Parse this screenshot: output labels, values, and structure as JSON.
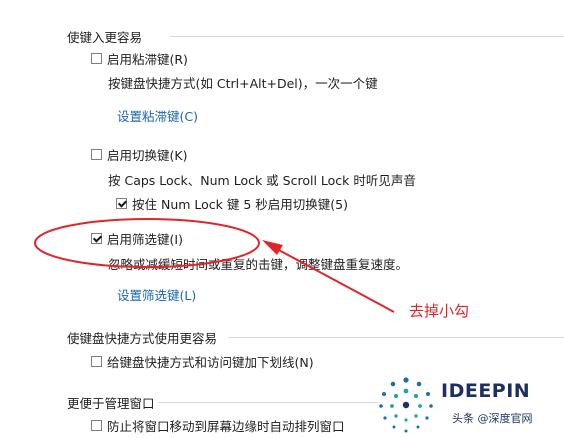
{
  "groups": [
    {
      "title": "使键入更容易",
      "sticky": {
        "label": "启用粘滞键(R)",
        "checked": false,
        "desc": "按键盘快捷方式(如 Ctrl+Alt+Del)，一次一个键",
        "link": "设置粘滞键(C)"
      },
      "toggle": {
        "label": "启用切换键(K)",
        "checked": false,
        "desc": "按 Caps Lock、Num Lock 或 Scroll Lock 时听见声音",
        "sub_label": "按住 Num Lock 键 5 秒启用切换键(5)",
        "sub_checked": true
      },
      "filter": {
        "label": "启用筛选键(I)",
        "checked": true,
        "desc": "忽略或减缓短时间或重复的击键，调整键盘重复速度。",
        "link": "设置筛选键(L)"
      }
    },
    {
      "title": "使键盘快捷方式使用更容易",
      "underline": {
        "label": "给键盘快捷方式和访问键加下划线(N)",
        "checked": false
      }
    },
    {
      "title": "更便于管理窗口",
      "arrange": {
        "label": "防止将窗口移动到屏幕边缘时自动排列窗口",
        "checked": false
      }
    }
  ],
  "annotation": {
    "text": "去掉小勾",
    "color": "#e0262a"
  },
  "watermark": {
    "logo": "IDEEPIN",
    "sub": "头条 @深度官网"
  }
}
